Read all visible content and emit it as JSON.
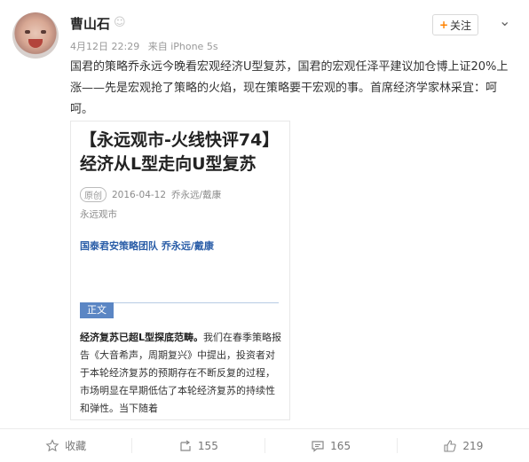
{
  "user": {
    "name": "曹山石",
    "badge_icon": "emoji-badge-icon"
  },
  "meta": {
    "date": "4月12日 22:29",
    "via": "来自 iPhone 5s"
  },
  "follow": {
    "label": "关注"
  },
  "post": {
    "text": "国君的策略乔永远今晚看宏观经济U型复苏，国君的宏观任泽平建议加仓博上证20%上涨——先是宏观抢了策略的火焰，现在策略要干宏观的事。首席经济学家林采宜：呵呵。"
  },
  "card": {
    "title_line1": "【永远观市-火线快评74】",
    "title_line2": "经济从L型走向U型复苏",
    "orig_tag": "原创",
    "date": "2016-04-12",
    "authors": "乔永远/戴康",
    "source": "永远观市",
    "team": "国泰君安策略团队  乔永远/戴康",
    "section_tag": "正文",
    "body_bold": "经济复苏已超L型探底范畴。",
    "body_rest": "我们在春季策略报告《大音希声，周期复兴》中提出，投资者对于本轮经济复苏的预期存在不断反复的过程，市场明显在早期低估了本轮经济复苏的持续性和弹性。当下随着"
  },
  "actions": {
    "favorite": "收藏",
    "repost": "155",
    "comment": "165",
    "like": "219"
  }
}
